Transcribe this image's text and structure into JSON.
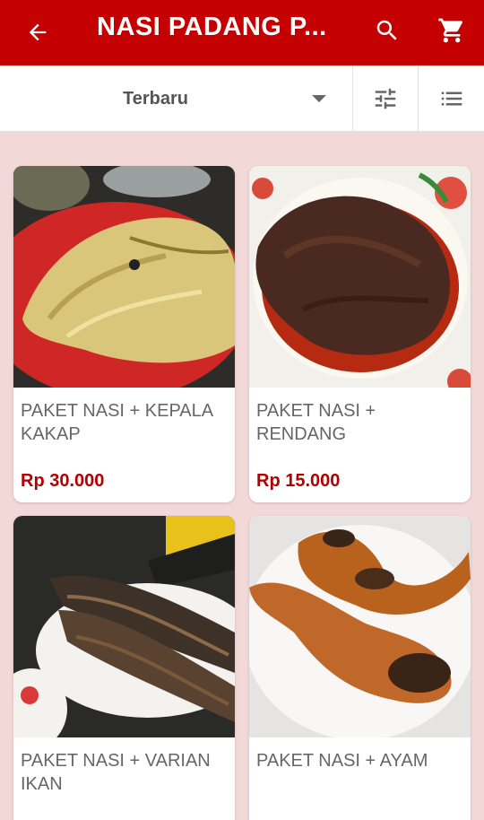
{
  "appbar": {
    "title": "NASI PADANG P...",
    "icons": [
      "back-arrow-icon",
      "search-icon",
      "cart-icon"
    ],
    "color": "#c40000"
  },
  "toolbar": {
    "sort_label": "Terbaru",
    "icons": [
      "chevron-down-icon",
      "filter-icon",
      "list-view-icon"
    ]
  },
  "products": [
    {
      "name": "PAKET NASI + KEPALA KAKAP",
      "price": "Rp 30.000"
    },
    {
      "name": "PAKET NASI + RENDANG",
      "price": "Rp 15.000"
    },
    {
      "name": "PAKET NASI + VARIAN IKAN",
      "price": ""
    },
    {
      "name": "PAKET NASI + AYAM",
      "price": ""
    }
  ],
  "colors": {
    "price": "#b30000",
    "background": "#f3d8d8"
  }
}
